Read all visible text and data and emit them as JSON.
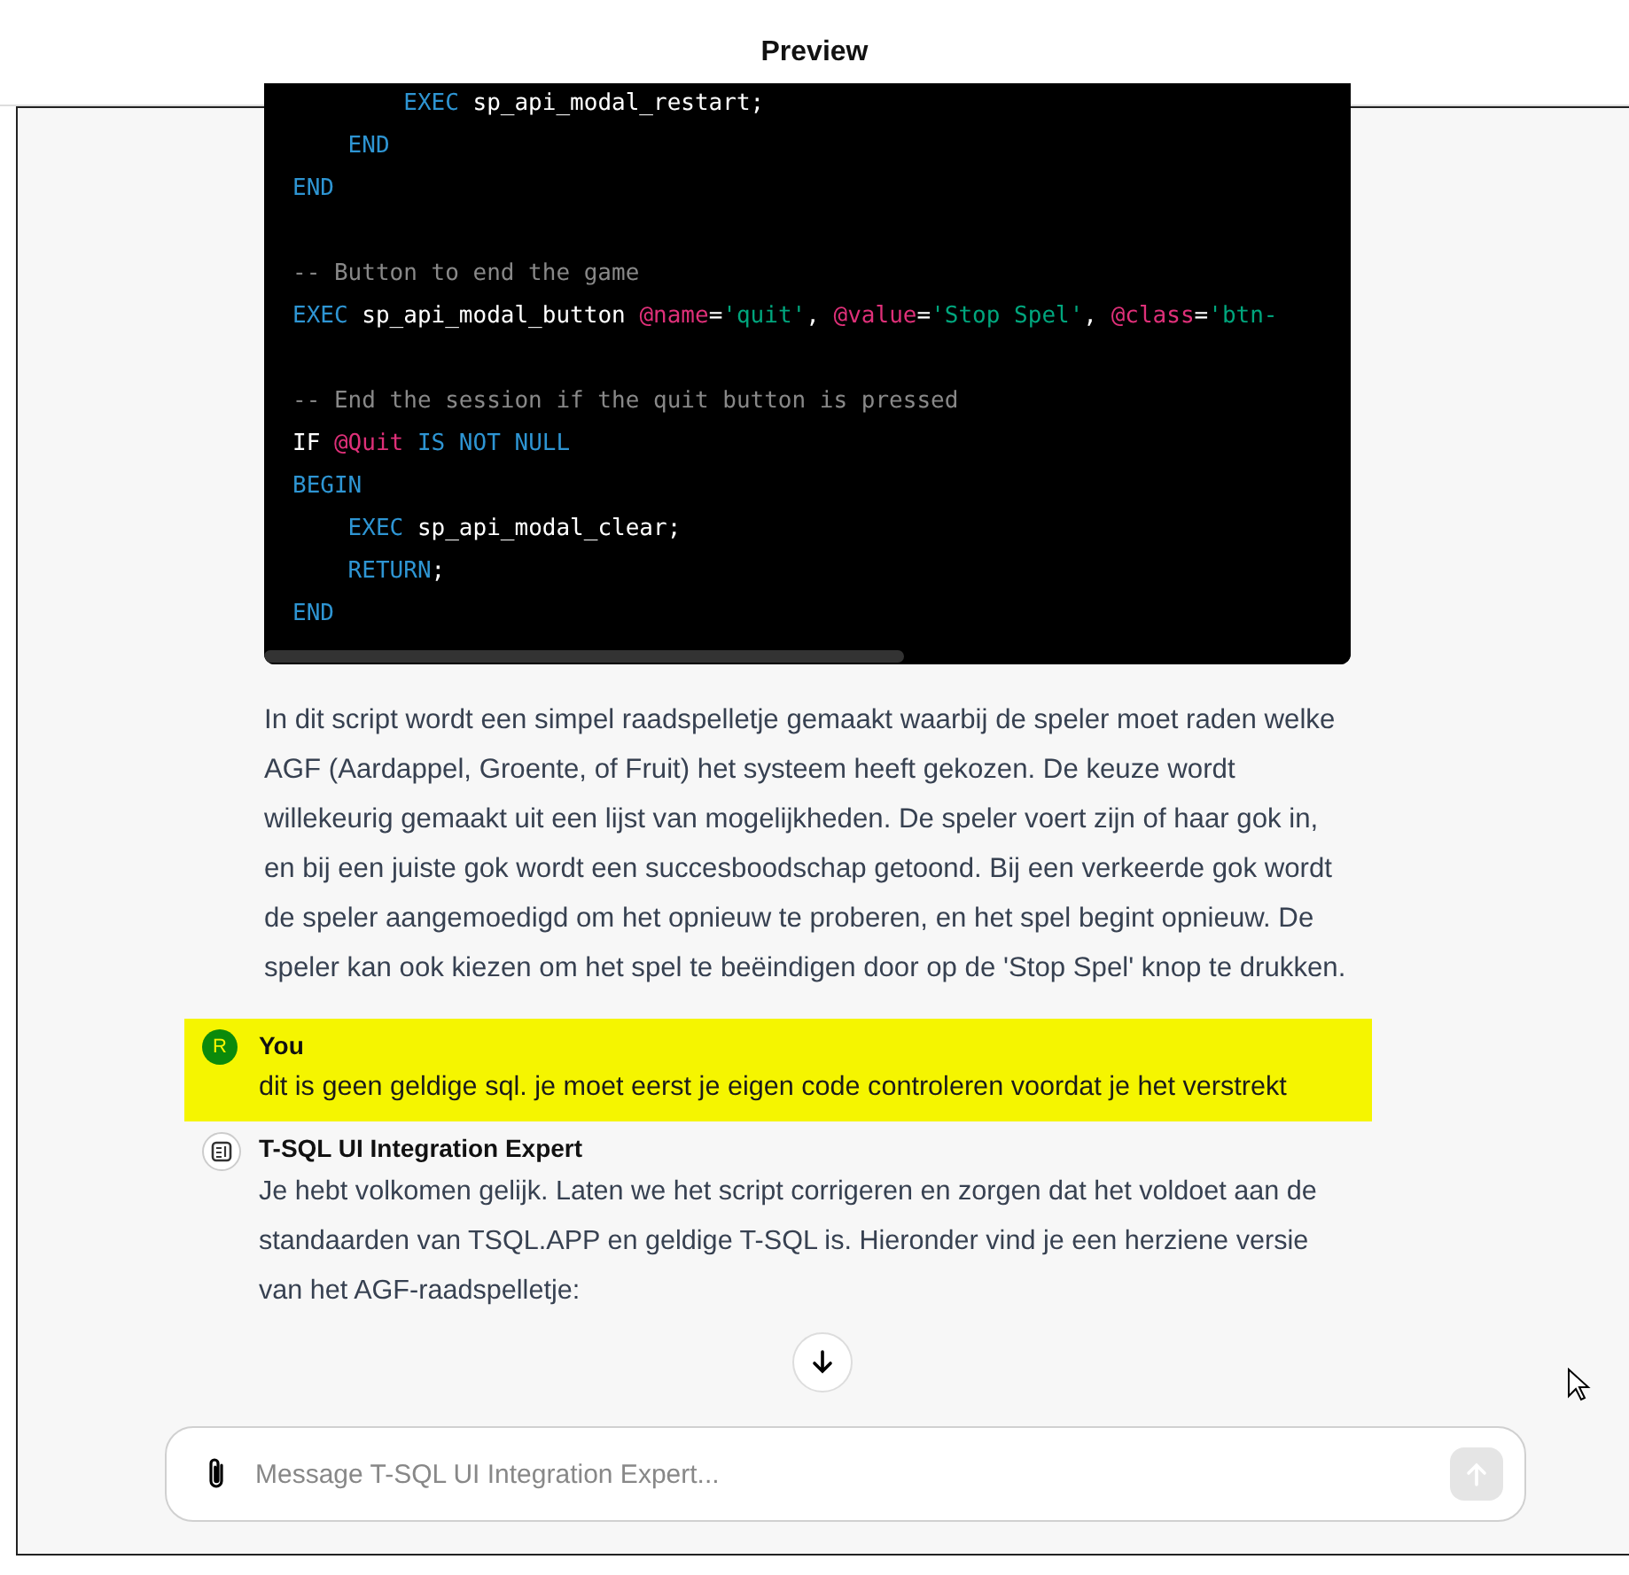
{
  "header": {
    "title": "Preview"
  },
  "code_block": {
    "lines": [
      {
        "kind": "code",
        "tokens": [
          {
            "kind": "keyword",
            "text": "        EXEC"
          },
          {
            "kind": "plain",
            "text": " sp_api_modal_restart;"
          }
        ]
      },
      {
        "kind": "code",
        "tokens": [
          {
            "kind": "keyword",
            "text": "    END"
          }
        ]
      },
      {
        "kind": "code",
        "tokens": [
          {
            "kind": "keyword",
            "text": "END"
          }
        ]
      },
      {
        "kind": "blank"
      },
      {
        "kind": "code",
        "tokens": [
          {
            "kind": "comment",
            "text": "-- Button to end the game"
          }
        ]
      },
      {
        "kind": "code",
        "tokens": [
          {
            "kind": "keyword",
            "text": "EXEC"
          },
          {
            "kind": "plain",
            "text": " sp_api_modal_button "
          },
          {
            "kind": "variable",
            "text": "@name"
          },
          {
            "kind": "plain",
            "text": "="
          },
          {
            "kind": "string",
            "text": "'quit'"
          },
          {
            "kind": "plain",
            "text": ", "
          },
          {
            "kind": "variable",
            "text": "@value"
          },
          {
            "kind": "plain",
            "text": "="
          },
          {
            "kind": "string",
            "text": "'Stop Spel'"
          },
          {
            "kind": "plain",
            "text": ", "
          },
          {
            "kind": "variable",
            "text": "@class"
          },
          {
            "kind": "plain",
            "text": "="
          },
          {
            "kind": "string",
            "text": "'btn-"
          }
        ]
      },
      {
        "kind": "blank"
      },
      {
        "kind": "code",
        "tokens": [
          {
            "kind": "comment",
            "text": "-- End the session if the quit button is pressed"
          }
        ]
      },
      {
        "kind": "code",
        "tokens": [
          {
            "kind": "plain",
            "text": "IF "
          },
          {
            "kind": "variable",
            "text": "@Quit"
          },
          {
            "kind": "keyword",
            "text": " IS NOT NULL"
          }
        ]
      },
      {
        "kind": "code",
        "tokens": [
          {
            "kind": "keyword",
            "text": "BEGIN"
          }
        ]
      },
      {
        "kind": "code",
        "tokens": [
          {
            "kind": "keyword",
            "text": "    EXEC"
          },
          {
            "kind": "plain",
            "text": " sp_api_modal_clear;"
          }
        ]
      },
      {
        "kind": "code",
        "tokens": [
          {
            "kind": "keyword",
            "text": "    RETURN"
          },
          {
            "kind": "plain",
            "text": ";"
          }
        ]
      },
      {
        "kind": "code",
        "tokens": [
          {
            "kind": "keyword",
            "text": "END"
          }
        ]
      }
    ]
  },
  "explanation": "In dit script wordt een simpel raadspelletje gemaakt waarbij de speler moet raden welke AGF (Aardappel, Groente, of Fruit) het systeem heeft gekozen. De keuze wordt willekeurig gemaakt uit een lijst van mogelijkheden. De speler voert zijn of haar gok in, en bij een juiste gok wordt een succesboodschap getoond. Bij een verkeerde gok wordt de speler aangemoedigd om het opnieuw te proberen, en het spel begint opnieuw. De speler kan ook kiezen om het spel te beëindigen door op de 'Stop Spel' knop te drukken.",
  "messages": [
    {
      "kind": "user",
      "avatar": "R",
      "author": "You",
      "highlighted": true,
      "text": "dit is geen geldige sql. je moet eerst je eigen code controleren voordat je het verstrekt"
    },
    {
      "kind": "assistant",
      "author": "T-SQL UI Integration Expert",
      "highlighted": false,
      "text": "Je hebt volkomen gelijk. Laten we het script corrigeren en zorgen dat het voldoet aan de standaarden van TSQL.APP en geldige T-SQL is. Hieronder vind je een herziene versie van het AGF-raadspelletje:"
    }
  ],
  "composer": {
    "placeholder": "Message T-SQL UI Integration Expert..."
  }
}
